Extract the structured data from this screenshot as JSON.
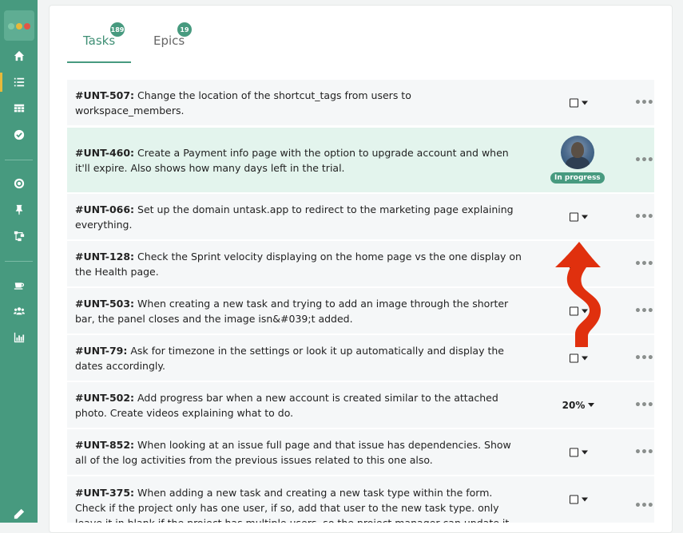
{
  "tabs": [
    {
      "label": "Tasks",
      "count": "189",
      "active": true
    },
    {
      "label": "Epics",
      "count": "19",
      "active": false
    }
  ],
  "sidebar": {
    "icons": [
      "home-icon",
      "list-icon",
      "board-icon",
      "check-circle-icon",
      "target-icon",
      "pin-icon",
      "hierarchy-icon",
      "coffee-icon",
      "users-icon",
      "chart-icon",
      "pencil-icon"
    ]
  },
  "tasks": [
    {
      "id": "#UNT-507:",
      "text": "Change the location of the shortcut_tags from users to workspace_members.",
      "status": "checkbox"
    },
    {
      "id": "#UNT-460:",
      "text": "Create a Payment info page with the option to upgrade account and when it'll expire. Also shows how many days left in the trial.",
      "status": "In progress"
    },
    {
      "id": "#UNT-066:",
      "text": "Set up the domain untask.app to redirect to the marketing page explaining everything.",
      "status": "checkbox"
    },
    {
      "id": "#UNT-128:",
      "text": "Check the Sprint velocity displaying on the home page vs the one display on the Health page.",
      "status": "checkbox"
    },
    {
      "id": "#UNT-503:",
      "text": "When creating a new task and trying to add an image through the shorter bar, the panel closes and the image isn&#039;t added.",
      "status": "checkbox"
    },
    {
      "id": "#UNT-79:",
      "text": "Ask for timezone in the settings or look it up automatically and display the dates accordingly.",
      "status": "checkbox"
    },
    {
      "id": "#UNT-502:",
      "text": "Add progress bar when a new account is created similar to the attached photo. Create videos explaining what to do.",
      "status": "20%"
    },
    {
      "id": "#UNT-852:",
      "text": "When looking at an issue full page and that issue has dependencies. Show all of the log activities from the previous issues related to this one also.",
      "status": "checkbox"
    },
    {
      "id": "#UNT-375:",
      "text": "When adding a new task and creating a new task type within the form. Check if the project only has one user, if so, add that user to the new task type. only leave it in blank if the project has multiple users, so the project manager can update it later.",
      "status": "checkbox"
    }
  ],
  "colors": {
    "accent": "#479a7f",
    "highlight": "#e3f4ed",
    "annotation_arrow": "#e0300e"
  }
}
